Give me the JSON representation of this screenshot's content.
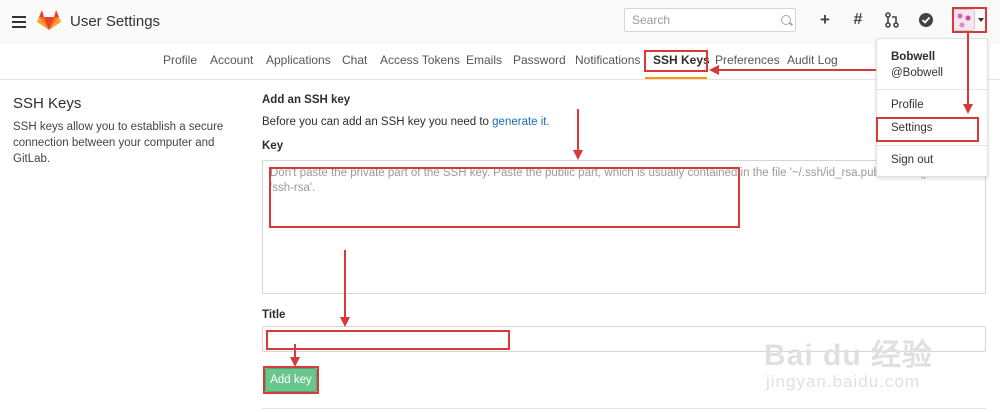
{
  "header": {
    "app_title": "User Settings",
    "search_placeholder": "Search",
    "icons": [
      "menu-icon",
      "gitlab-logo-icon",
      "search-icon",
      "plus-icon",
      "hash-icon",
      "merge-request-icon",
      "todo-check-icon",
      "avatar",
      "caret-down-icon"
    ]
  },
  "subnav": {
    "tabs": [
      {
        "label": "Profile"
      },
      {
        "label": "Account"
      },
      {
        "label": "Applications"
      },
      {
        "label": "Chat"
      },
      {
        "label": "Access Tokens"
      },
      {
        "label": "Emails"
      },
      {
        "label": "Password"
      },
      {
        "label": "Notifications"
      },
      {
        "label": "SSH Keys",
        "active": true
      },
      {
        "label": "Preferences"
      },
      {
        "label": "Audit Log"
      }
    ]
  },
  "sidebar": {
    "title": "SSH Keys",
    "description": "SSH keys allow you to establish a secure connection between your computer and GitLab."
  },
  "form": {
    "heading": "Add an SSH key",
    "intro_text": "Before you can add an SSH key you need to ",
    "intro_link": "generate it.",
    "key_label": "Key",
    "key_placeholder": "Don't paste the private part of the SSH key. Paste the public part, which is usually contained in the file '~/.ssh/id_rsa.pub' and begins with 'ssh-rsa'.",
    "title_label": "Title",
    "title_value": "",
    "submit_label": "Add key"
  },
  "dropdown": {
    "user_name": "Bobwell",
    "user_handle": "@Bobwell",
    "items": [
      "Profile",
      "Settings",
      "Sign out"
    ]
  },
  "watermark": {
    "main": "Bai du 经验",
    "sub": "jingyan.baidu.com"
  },
  "colors": {
    "accent": "#fc9403",
    "link": "#1b69b6",
    "button": "#69c68c",
    "annotation": "#d9393b"
  }
}
